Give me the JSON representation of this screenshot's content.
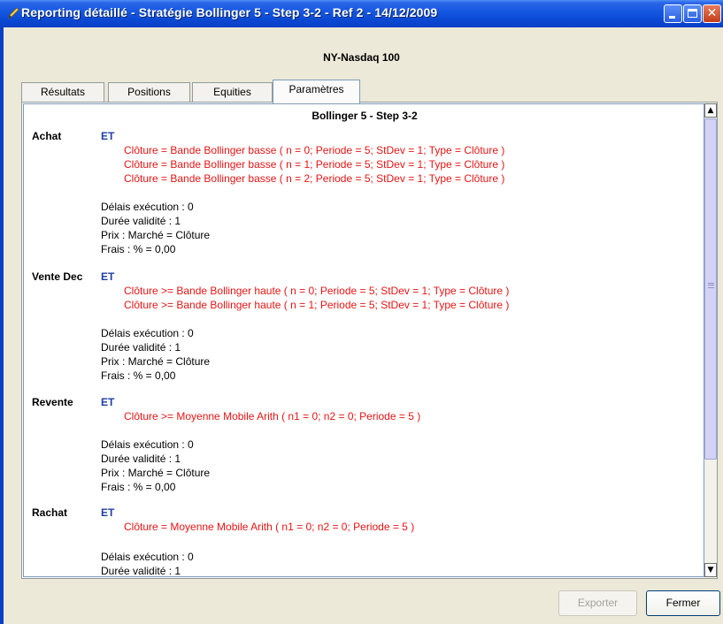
{
  "window": {
    "title": "Reporting détaillé - Stratégie Bollinger 5 - Step 3-2 - Ref 2 - 14/12/2009",
    "controls": {
      "close_glyph": "✕"
    }
  },
  "market": "NY-Nasdaq 100",
  "tabs": [
    "Résultats",
    "Positions",
    "Equities",
    "Paramètres"
  ],
  "active_tab": "Paramètres",
  "strategy_title": "Bollinger 5 - Step 3-2",
  "sections": [
    {
      "label": "Achat",
      "operator": "ET",
      "conditions": [
        "Clôture = Bande Bollinger basse ( n = 0; Periode = 5; StDev = 1; Type = Clôture )",
        "Clôture = Bande Bollinger basse ( n = 1; Periode = 5; StDev = 1; Type = Clôture )",
        "Clôture = Bande Bollinger basse ( n = 2; Periode = 5; StDev = 1; Type = Clôture )"
      ],
      "params": [
        "Délais exécution : 0",
        "Durée validité : 1",
        "Prix : Marché = Clôture",
        "Frais : % = 0,00"
      ]
    },
    {
      "label": "Vente Dec",
      "operator": "ET",
      "conditions": [
        "Clôture >= Bande Bollinger haute ( n = 0; Periode = 5; StDev = 1; Type = Clôture )",
        "Clôture >= Bande Bollinger haute ( n = 1; Periode = 5; StDev = 1; Type = Clôture )"
      ],
      "params": [
        "Délais exécution : 0",
        "Durée validité : 1",
        "Prix : Marché = Clôture",
        "Frais : % = 0,00"
      ]
    },
    {
      "label": "Revente",
      "operator": "ET",
      "conditions": [
        "Clôture >= Moyenne Mobile Arith ( n1 = 0; n2 = 0; Periode = 5 )"
      ],
      "params": [
        "Délais exécution : 0",
        "Durée validité : 1",
        "Prix : Marché = Clôture",
        "Frais : % = 0,00"
      ]
    },
    {
      "label": "Rachat",
      "operator": "ET",
      "conditions": [
        "Clôture = Moyenne Mobile Arith ( n1 = 0; n2 = 0; Periode = 5 )"
      ],
      "params": [
        "Délais exécution : 0",
        "Durée validité : 1"
      ]
    }
  ],
  "scrollbar": {
    "up_glyph": "▲",
    "down_glyph": "▼"
  },
  "buttons": {
    "export": "Exporter",
    "close": "Fermer"
  }
}
